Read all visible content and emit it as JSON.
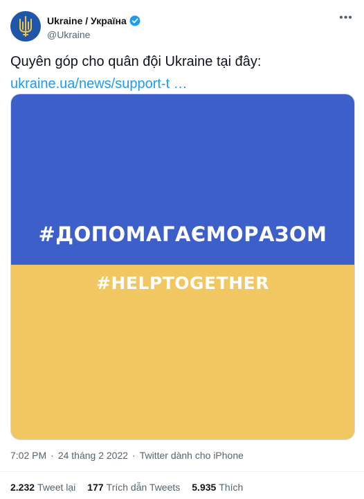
{
  "account": {
    "display_name": "Ukraine / Україна",
    "handle": "@Ukraine",
    "verified_icon": "verified-badge-icon",
    "avatar_icon": "trident-coat-of-arms-icon"
  },
  "more_icon": "more-options-icon",
  "tweet": {
    "text": "Quyên góp cho quân đội Ukraine tại đây:",
    "link": "ukraine.ua/news/support-t …"
  },
  "media": {
    "hashtag_ukrainian": "#ДОПОМАГАЄМОРАЗОМ",
    "hashtag_english": "#HELPTOGETHER",
    "colors": {
      "blue": "#3c5fca",
      "yellow": "#f0c761"
    }
  },
  "meta": {
    "time": "7:02 PM",
    "separator": "·",
    "date": "24 tháng 2 2022",
    "source": "Twitter dành cho iPhone"
  },
  "stats": [
    {
      "value": "2.232",
      "label": "Tweet lại"
    },
    {
      "value": "177",
      "label": "Trích dẫn Tweets"
    },
    {
      "value": "5.935",
      "label": "Thích"
    }
  ]
}
